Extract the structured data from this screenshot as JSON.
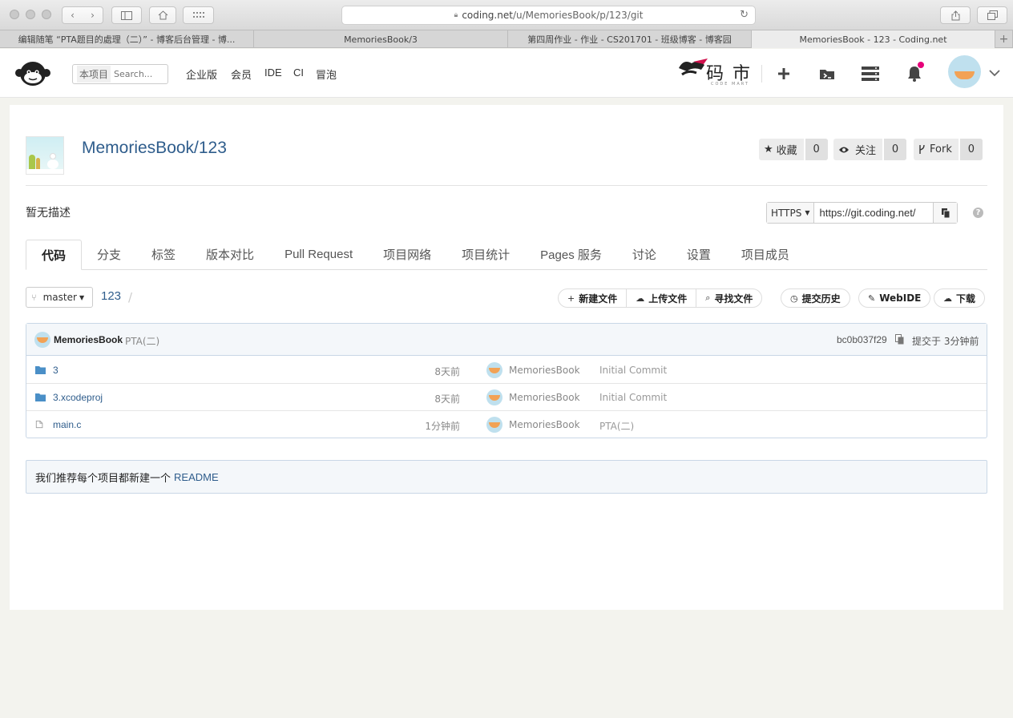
{
  "browser": {
    "url_domain": "coding.net",
    "url_path": "/u/MemoriesBook/p/123/git",
    "tabs": [
      {
        "label": "编辑随笔 “PTA题目的處理（二）” - 博客后台管理 - 博..."
      },
      {
        "label": "MemoriesBook/3"
      },
      {
        "label": "第四周作业 - 作业 - CS201701 - 班级博客 - 博客园"
      },
      {
        "label": "MemoriesBook - 123 - Coding.net"
      }
    ]
  },
  "header": {
    "search_scope": "本项目",
    "search_placeholder": "Search...",
    "nav": [
      "企业版",
      "会员",
      "IDE",
      "CI",
      "冒泡"
    ],
    "mart_logo_text": "码 市",
    "mart_logo_sub": "CODE MART",
    "notification_badge_color": "#e6007a"
  },
  "repo": {
    "title": "MemoriesBook/123",
    "star_label": "收藏",
    "star_count": "0",
    "watch_label": "关注",
    "watch_count": "0",
    "fork_label": "Fork",
    "fork_count": "0",
    "description": "暂无描述",
    "clone_protocol": "HTTPS",
    "clone_url": "https://git.coding.net/"
  },
  "tabs": [
    "代码",
    "分支",
    "标签",
    "版本对比",
    "Pull Request",
    "项目网络",
    "项目统计",
    "Pages 服务",
    "讨论",
    "设置",
    "项目成员"
  ],
  "active_tab": 0,
  "toolbar": {
    "branch": "master",
    "path_root": "123",
    "path_sep": "/",
    "new_file": "新建文件",
    "upload_file": "上传文件",
    "find_file": "寻找文件",
    "history": "提交历史",
    "webide": "WebIDE",
    "download": "下载"
  },
  "last_commit": {
    "author": "MemoriesBook",
    "message": "PTA(二)",
    "hash": "bc0b037f29",
    "time": "提交于 3分钟前"
  },
  "files": [
    {
      "name": "3",
      "type": "folder",
      "time": "8天前",
      "author": "MemoriesBook",
      "message": "Initial Commit"
    },
    {
      "name": "3.xcodeproj",
      "type": "folder",
      "time": "8天前",
      "author": "MemoriesBook",
      "message": "Initial Commit"
    },
    {
      "name": "main.c",
      "type": "file",
      "time": "1分钟前",
      "author": "MemoriesBook",
      "message": "PTA(二)"
    }
  ],
  "readme": {
    "text": "我们推荐每个项目都新建一个",
    "link": "README"
  },
  "colors": {
    "link": "#2f5d8c",
    "page_bg": "#f3f3ee",
    "box_border": "#c9d7e6"
  }
}
